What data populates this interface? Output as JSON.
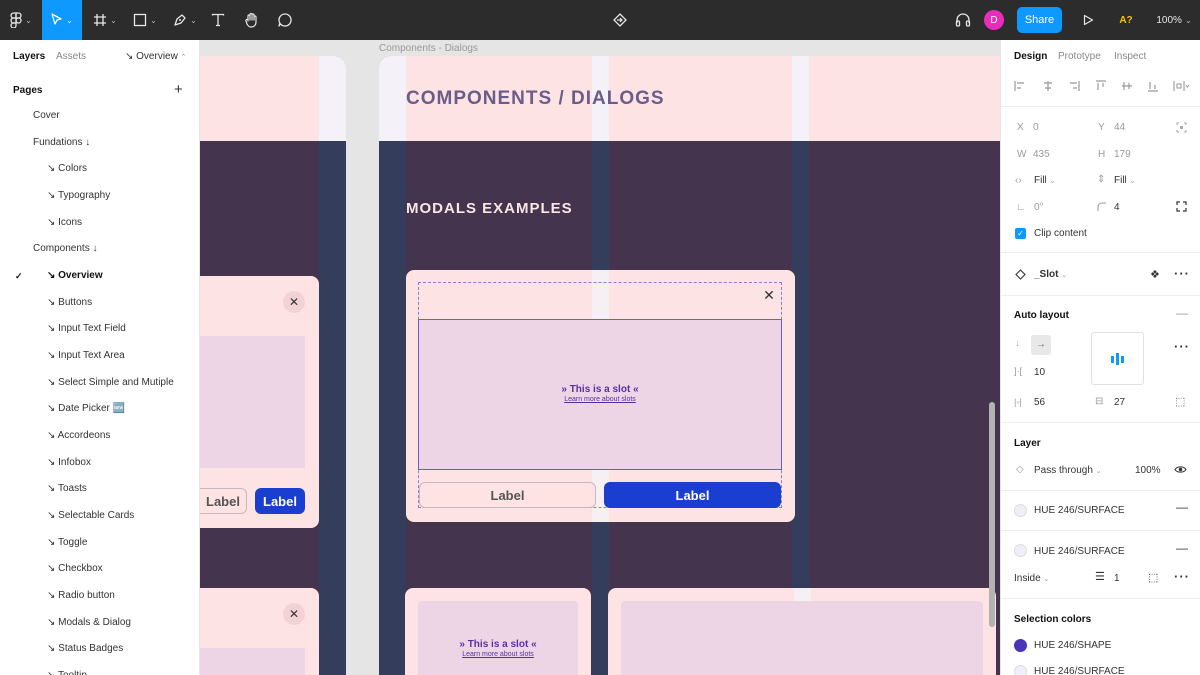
{
  "toolbar": {
    "share_label": "Share",
    "avatar_initial": "D",
    "accessibility_label": "A?",
    "zoom": "100%"
  },
  "sidebar": {
    "tabs": [
      "Layers",
      "Assets"
    ],
    "page_selector": "↘ Overview",
    "pages_title": "Pages",
    "pages": [
      "Cover",
      "Fundations ↓",
      "↘ Colors",
      "↘ Typography",
      "↘ Icons",
      "Components ↓",
      "↘ Overview",
      "↘ Buttons",
      "↘ Input Text Field",
      "↘ Input Text Area",
      "↘ Select Simple and  Mutiple",
      "↘ Date Picker 🆕",
      "↘ Accordeons",
      "↘ Infobox",
      "↘ Toasts",
      "↘ Selectable Cards",
      "↘ Toggle",
      "↘ Checkbox",
      "↘ Radio button",
      "↘ Modals & Dialog",
      "↘ Status Badges",
      "↘ Tooltip"
    ]
  },
  "canvas": {
    "frame_label": "Components - Dialogs",
    "heading": "COMPONENTS / DIALOGS",
    "subheading": "MODALS EXAMPLES",
    "slot_text": "This is a slot",
    "slot_link": "Learn more about slots",
    "secondary_label": "Label",
    "primary_label": "Label",
    "close_glyph": "✕"
  },
  "rpanel": {
    "tabs": [
      "Design",
      "Prototype",
      "Inspect"
    ],
    "x_label": "X",
    "x": "0",
    "y_label": "Y",
    "y": "44",
    "w_label": "W",
    "w": "435",
    "h_label": "H",
    "h": "179",
    "hsize": "Fill",
    "vsize": "Fill",
    "rotation": "0°",
    "radius": "4",
    "clip_content": "Clip content",
    "component": "_Slot",
    "auto_layout_title": "Auto layout",
    "spacing": "10",
    "padding_h": "56",
    "padding_v": "27",
    "layer_title": "Layer",
    "blend": "Pass through",
    "opacity": "100%",
    "fill1": "HUE 246/SURFACE",
    "fill2": "HUE 246/SURFACE",
    "stroke_position": "Inside",
    "stroke_weight": "1",
    "selection_colors_title": "Selection colors",
    "sel1": "HUE 246/SHAPE",
    "sel2": "HUE 246/SURFACE"
  },
  "colors": {
    "accent": "#0d99ff",
    "primary_button": "#1a3fd0",
    "dark_band": "#45344d",
    "pink": "#fde3e3",
    "navy": "#353d5c",
    "avatar": "#e92cbb",
    "shape_swatch": "#4b34b8"
  }
}
